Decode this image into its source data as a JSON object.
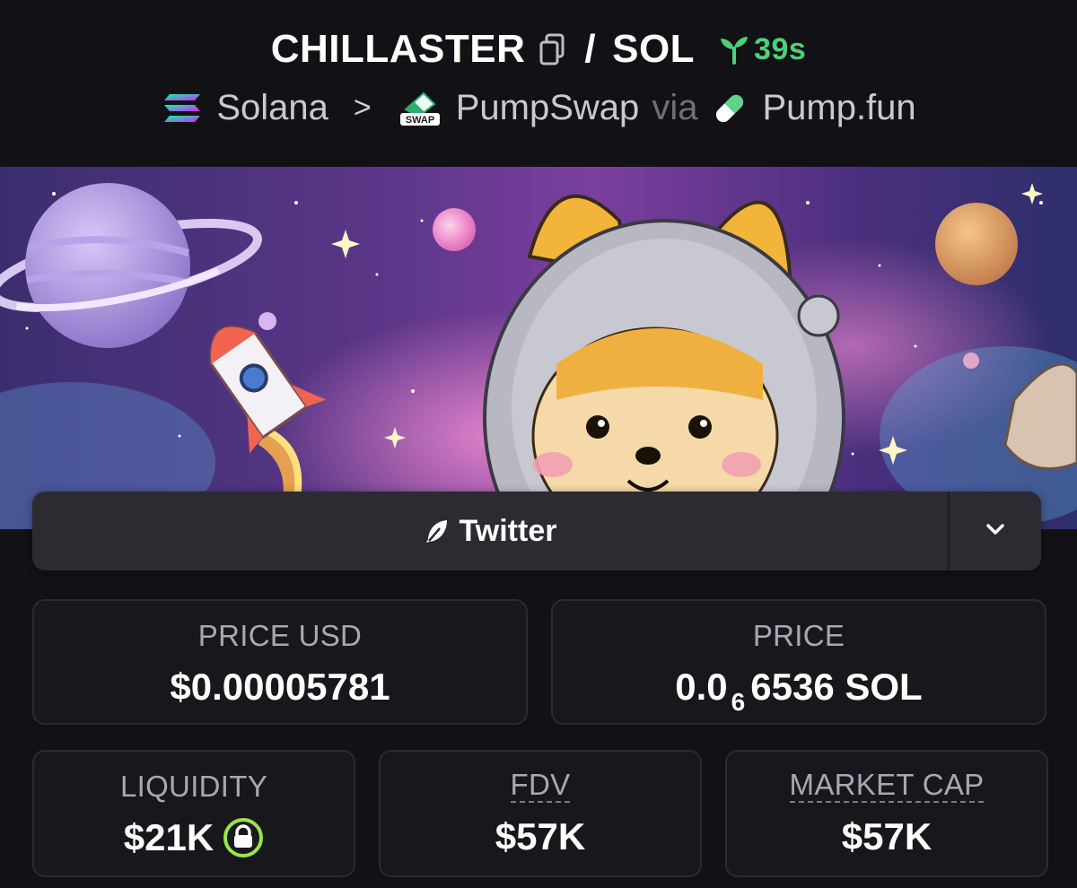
{
  "header": {
    "token": "CHILLASTER",
    "separator": "/",
    "quote": "SOL",
    "age": "39s",
    "chain": "Solana",
    "chain_sep": ">",
    "dex": "PumpSwap",
    "via": "via",
    "launchpad": "Pump.fun",
    "dex_icon_text": "SWAP"
  },
  "icons": {
    "copy": "copy-icon",
    "age": "sprout-icon",
    "chain": "solana-icon",
    "dex": "pumpswap-icon",
    "launchpad": "pill-icon",
    "social": "feather-icon",
    "dropdown": "chevron-down-icon",
    "lock": "lock-icon"
  },
  "social": {
    "label": "Twitter"
  },
  "stats": {
    "price_usd": {
      "label": "PRICE USD",
      "value": "$0.00005781"
    },
    "price": {
      "label": "PRICE",
      "prefix": "0.0",
      "zeros": "6",
      "suffix": "6536 SOL"
    },
    "liquidity": {
      "label": "LIQUIDITY",
      "value": "$21K"
    },
    "fdv": {
      "label": "FDV",
      "value": "$57K"
    },
    "market_cap": {
      "label": "MARKET CAP",
      "value": "$57K"
    }
  },
  "colors": {
    "background": "#121216",
    "age_green": "#4cd17a",
    "card_border": "#2a2a30",
    "lock_ring": "#9be44a"
  }
}
